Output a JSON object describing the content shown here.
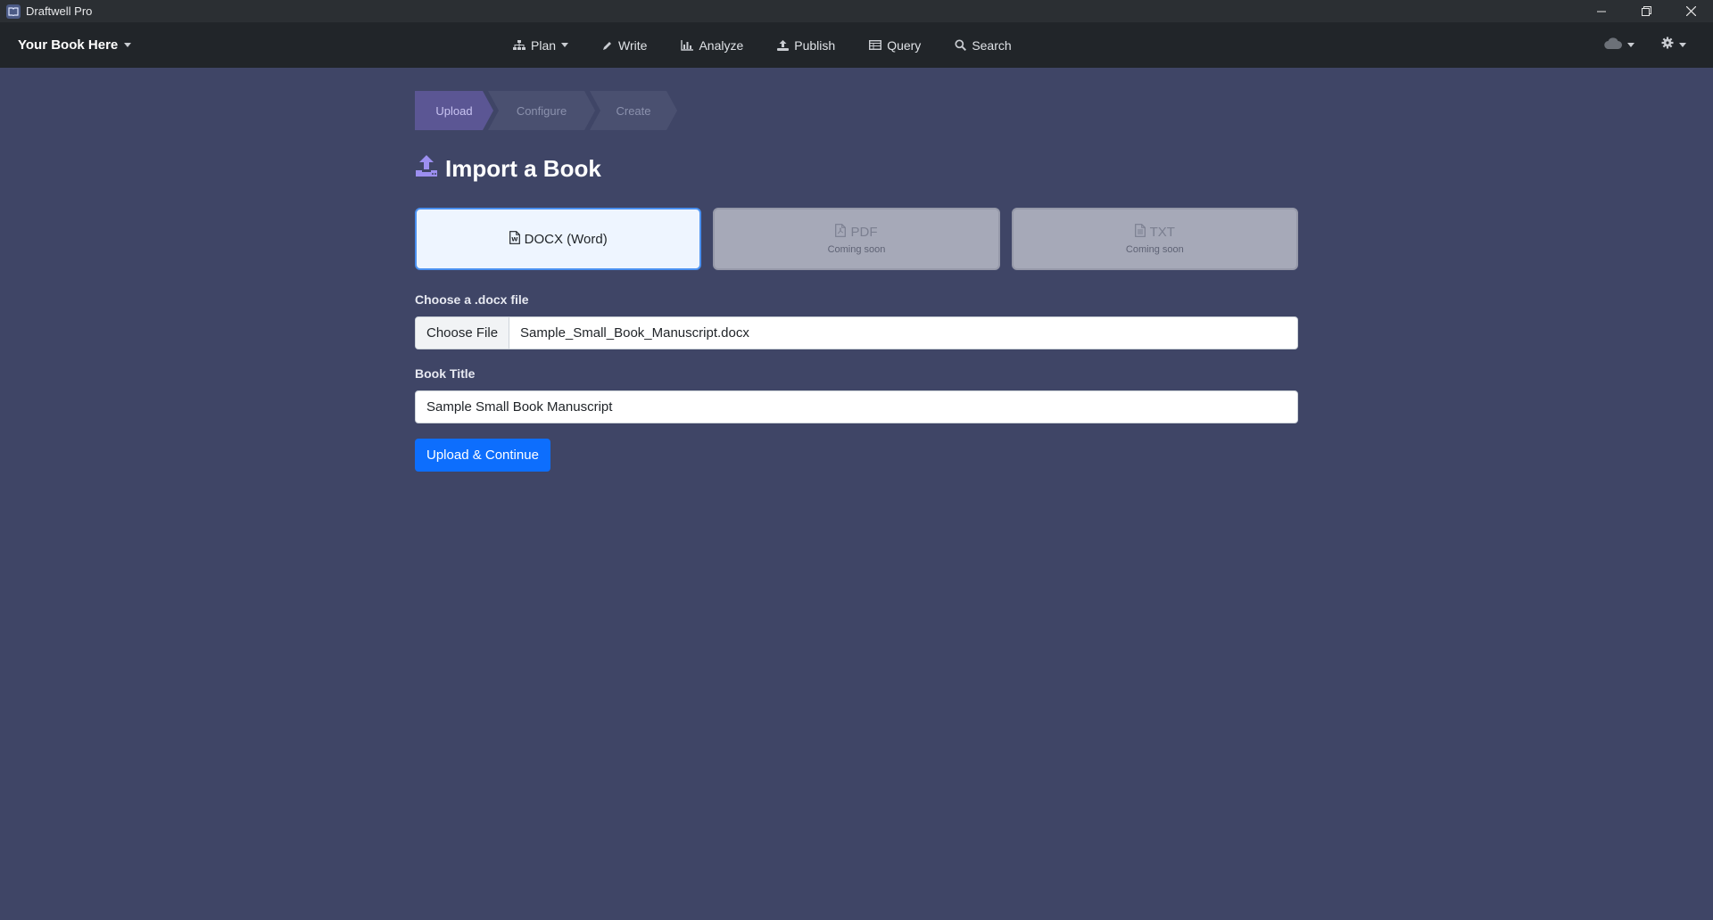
{
  "window": {
    "title": "Draftwell Pro"
  },
  "navbar": {
    "brand": "Your Book Here",
    "items": [
      {
        "label": "Plan",
        "icon": "sitemap-icon",
        "dropdown": true
      },
      {
        "label": "Write",
        "icon": "pencil-icon"
      },
      {
        "label": "Analyze",
        "icon": "bar-chart-icon"
      },
      {
        "label": "Publish",
        "icon": "upload-icon"
      },
      {
        "label": "Query",
        "icon": "table-icon"
      },
      {
        "label": "Search",
        "icon": "search-icon"
      }
    ],
    "right": [
      {
        "icon": "cloud-icon",
        "dropdown": true
      },
      {
        "icon": "gear-icon",
        "dropdown": true
      }
    ]
  },
  "stepper": {
    "steps": [
      "Upload",
      "Configure",
      "Create"
    ],
    "active": "Upload"
  },
  "page": {
    "title": "Import a Book"
  },
  "formats": [
    {
      "label": "DOCX (Word)",
      "subtitle": "",
      "state": "selected"
    },
    {
      "label": "PDF",
      "subtitle": "Coming soon",
      "state": "disabled"
    },
    {
      "label": "TXT",
      "subtitle": "Coming soon",
      "state": "disabled"
    }
  ],
  "form": {
    "file_label": "Choose a .docx file",
    "file_button": "Choose File",
    "file_name": "Sample_Small_Book_Manuscript.docx",
    "title_label": "Book Title",
    "title_value": "Sample Small Book Manuscript",
    "submit": "Upload & Continue"
  },
  "colors": {
    "background": "#3f4566",
    "navbar": "#212529",
    "primary": "#0d6efd",
    "accent": "#8b7fd6"
  }
}
